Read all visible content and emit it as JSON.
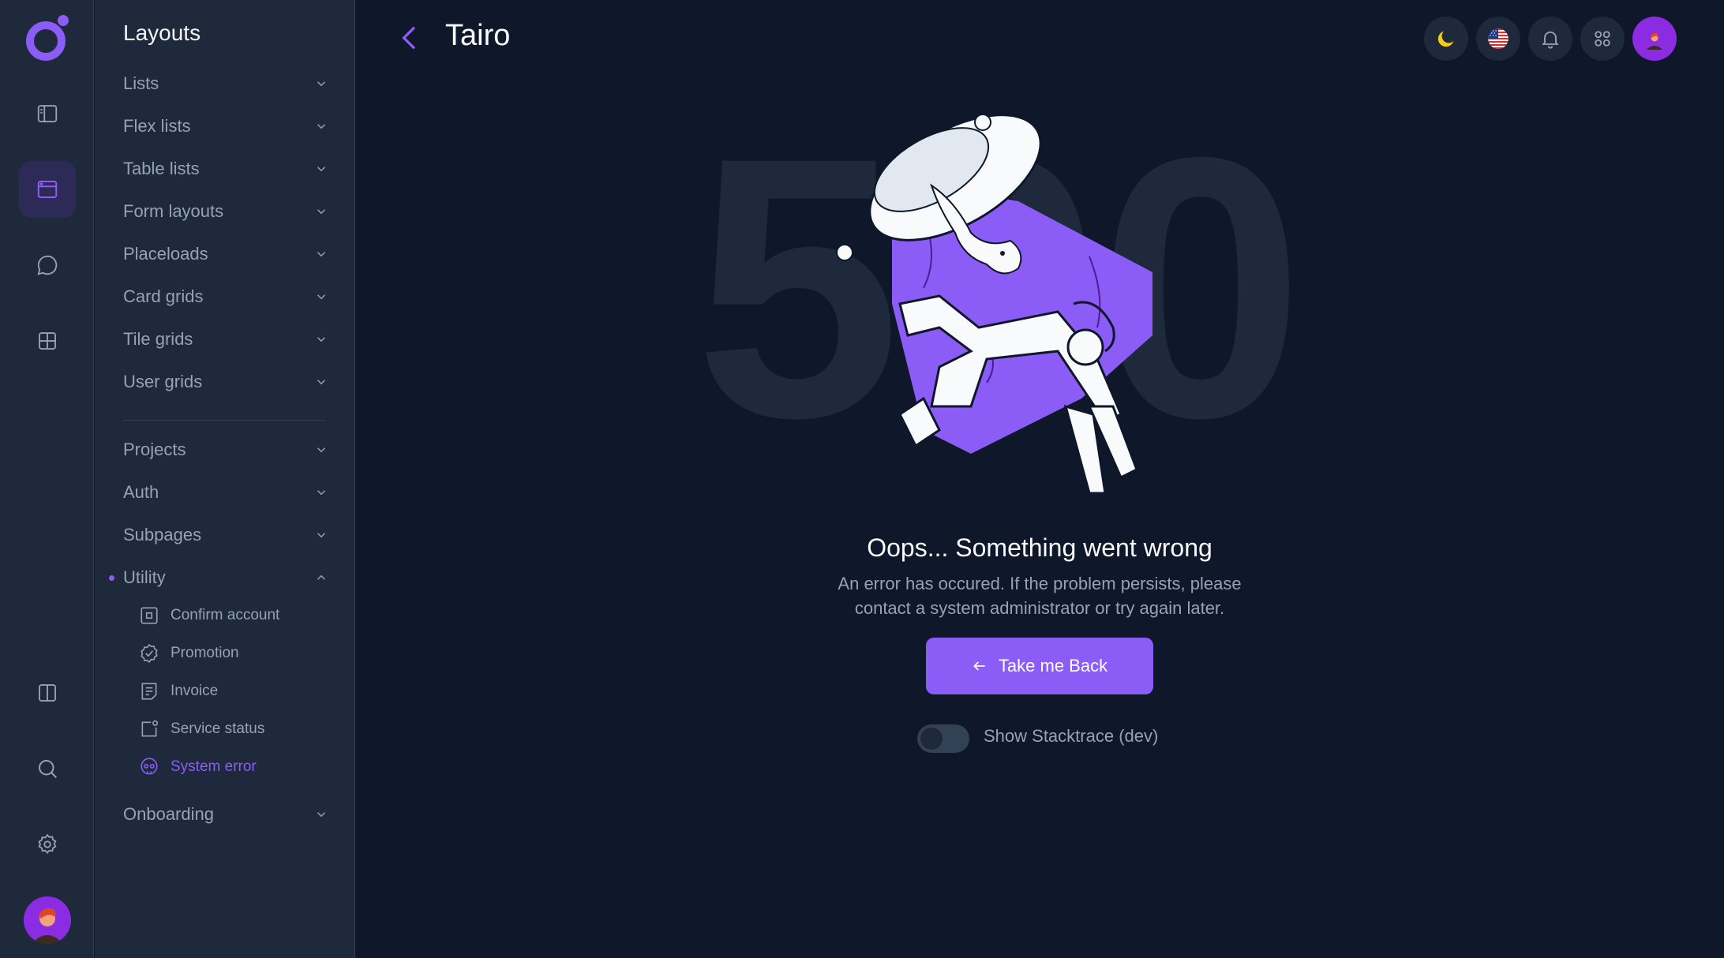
{
  "app": {
    "title": "Tairo"
  },
  "panel": {
    "title": "Layouts",
    "items": [
      {
        "label": "Lists"
      },
      {
        "label": "Flex lists"
      },
      {
        "label": "Table lists"
      },
      {
        "label": "Form layouts"
      },
      {
        "label": "Placeloads"
      },
      {
        "label": "Card grids"
      },
      {
        "label": "Tile grids"
      },
      {
        "label": "User grids"
      },
      {
        "label": "Projects"
      },
      {
        "label": "Auth"
      },
      {
        "label": "Subpages"
      },
      {
        "label": "Utility"
      },
      {
        "label": "Onboarding"
      }
    ],
    "utility_sub": [
      {
        "label": "Confirm account",
        "icon": "square-dot-icon"
      },
      {
        "label": "Promotion",
        "icon": "badge-check-icon"
      },
      {
        "label": "Invoice",
        "icon": "invoice-icon"
      },
      {
        "label": "Service status",
        "icon": "status-icon"
      },
      {
        "label": "System error",
        "icon": "skull-icon"
      }
    ],
    "active_sub": "System error"
  },
  "error": {
    "code": "500",
    "title": "Oops... Something went wrong",
    "desc_line1": "An error has occured. If the problem persists, please",
    "desc_line2": "contact a system administrator or try again later.",
    "button": "Take me Back",
    "toggle_label": "Show Stacktrace (dev)",
    "toggle_on": false
  },
  "colors": {
    "accent": "#8b5cf6",
    "bg": "#0f172a",
    "panel": "#1e293b"
  }
}
